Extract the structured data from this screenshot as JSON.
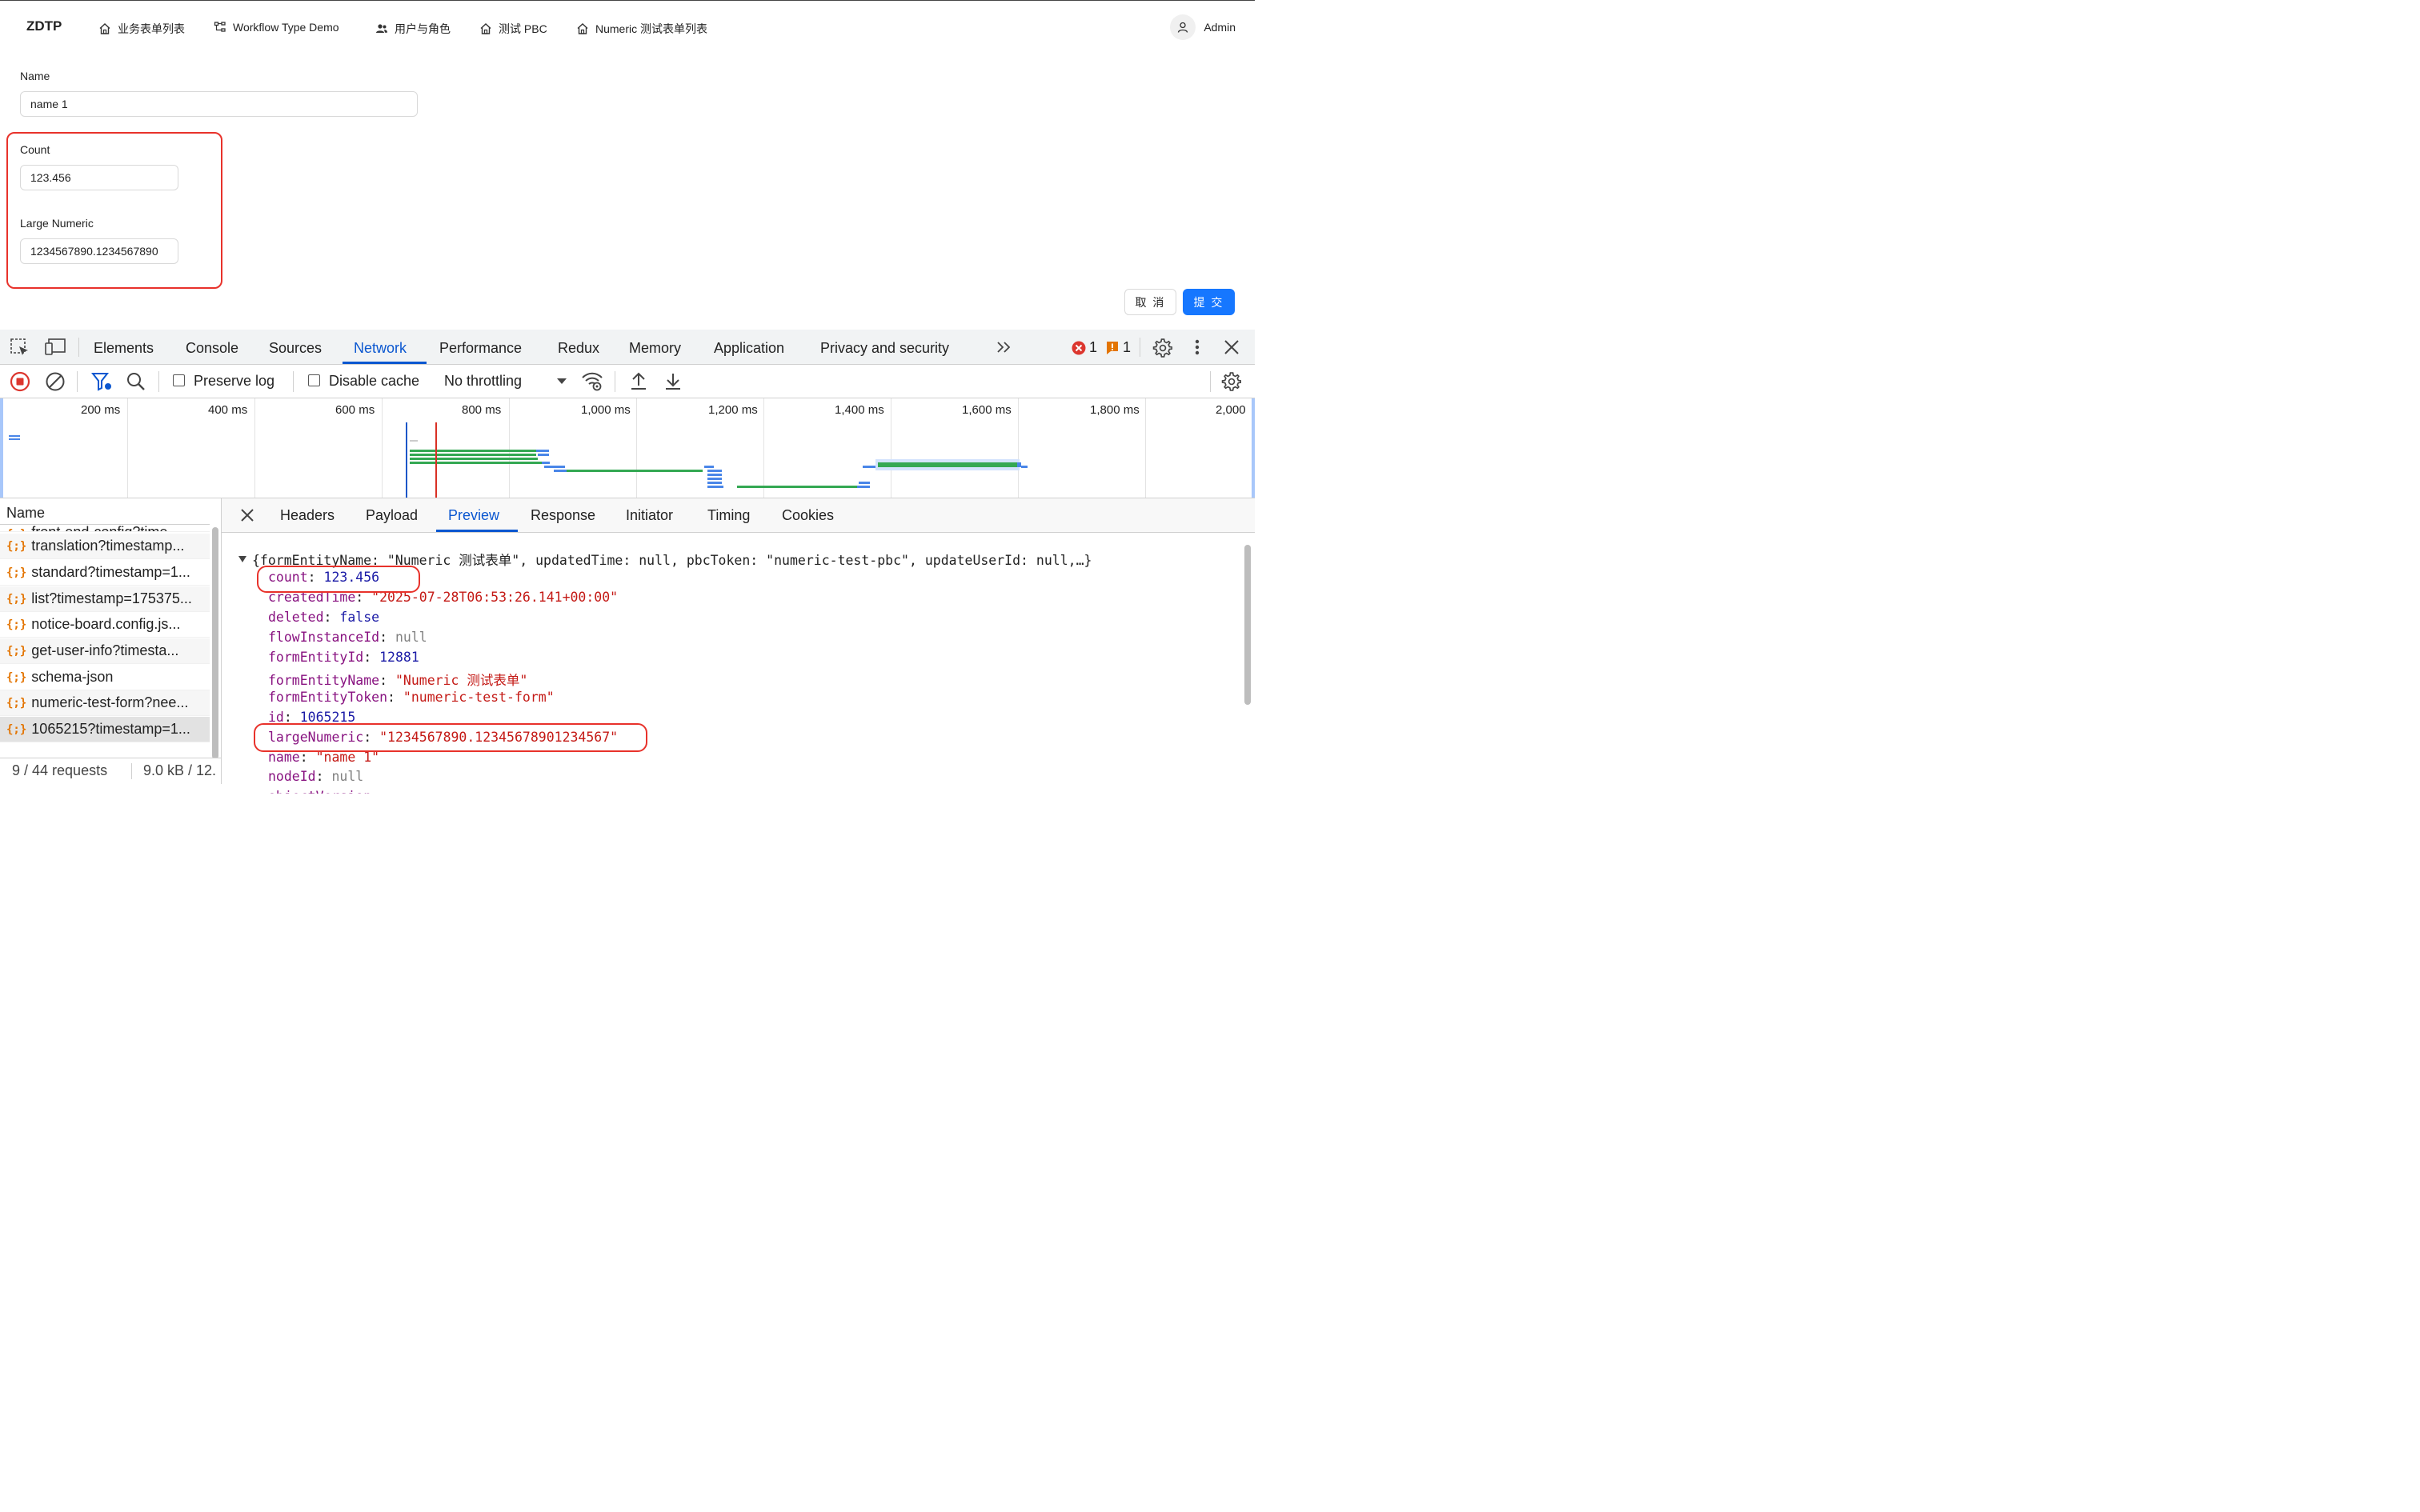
{
  "app": {
    "logo": "ZDTP",
    "nav": [
      {
        "label": "业务表单列表",
        "icon": "home-icon"
      },
      {
        "label": "Workflow Type Demo",
        "icon": "workflow-icon"
      },
      {
        "label": "用户与角色",
        "icon": "users-icon"
      },
      {
        "label": "测试 PBC",
        "icon": "home-icon"
      },
      {
        "label": "Numeric 测试表单列表",
        "icon": "home-icon"
      }
    ],
    "user": {
      "name": "Admin",
      "icon": "user-icon"
    },
    "form": {
      "name_label": "Name",
      "name_value": "name 1",
      "count_label": "Count",
      "count_value": "123.456",
      "large_label": "Large Numeric",
      "large_value": "1234567890.1234567890"
    },
    "buttons": {
      "cancel": "取 消",
      "submit": "提 交"
    }
  },
  "devtools": {
    "tabs": [
      "Elements",
      "Console",
      "Sources",
      "Network",
      "Performance",
      "Redux",
      "Memory",
      "Application",
      "Privacy and security"
    ],
    "active_tab": "Network",
    "error_count": "1",
    "warning_count": "1",
    "toolbar": {
      "preserve_log": "Preserve log",
      "disable_cache": "Disable cache",
      "throttling": "No throttling"
    },
    "timeline_labels": [
      "200 ms",
      "400 ms",
      "600 ms",
      "800 ms",
      "1,000 ms",
      "1,200 ms",
      "1,400 ms",
      "1,600 ms",
      "1,800 ms",
      "2,000"
    ],
    "requests_header": "Name",
    "requests": [
      "front-end-config?time...",
      "translation?timestamp...",
      "standard?timestamp=1...",
      "list?timestamp=175375...",
      "notice-board.config.js...",
      "get-user-info?timesta...",
      "schema-json",
      "numeric-test-form?nee...",
      "1065215?timestamp=1..."
    ],
    "status": {
      "requests": "9 / 44 requests",
      "size": "9.0 kB / 12."
    },
    "detail_tabs": [
      "Headers",
      "Payload",
      "Preview",
      "Response",
      "Initiator",
      "Timing",
      "Cookies"
    ],
    "active_detail_tab": "Preview",
    "preview": {
      "summary": "{formEntityName: \"Numeric 测试表单\", updatedTime: null, pbcToken: \"numeric-test-pbc\", updateUserId: null,…}",
      "count_key": "count",
      "count_val": "123.456",
      "createdTime_key": "createdTime",
      "createdTime_val": "\"2025-07-28T06:53:26.141+00:00\"",
      "deleted_key": "deleted",
      "deleted_val": "false",
      "flowInstanceId_key": "flowInstanceId",
      "flowInstanceId_val": "null",
      "formEntityId_key": "formEntityId",
      "formEntityId_val": "12881",
      "formEntityName_key": "formEntityName",
      "formEntityName_val": "\"Numeric 测试表单\"",
      "formEntityToken_key": "formEntityToken",
      "formEntityToken_val": "\"numeric-test-form\"",
      "id_key": "id",
      "id_val": "1065215",
      "largeNumeric_key": "largeNumeric",
      "largeNumeric_val": "\"1234567890.12345678901234567\"",
      "name_key": "name",
      "name_val": "\"name 1\"",
      "nodeId_key": "nodeId",
      "nodeId_val": "null",
      "partial_key": "objectVersion"
    }
  }
}
